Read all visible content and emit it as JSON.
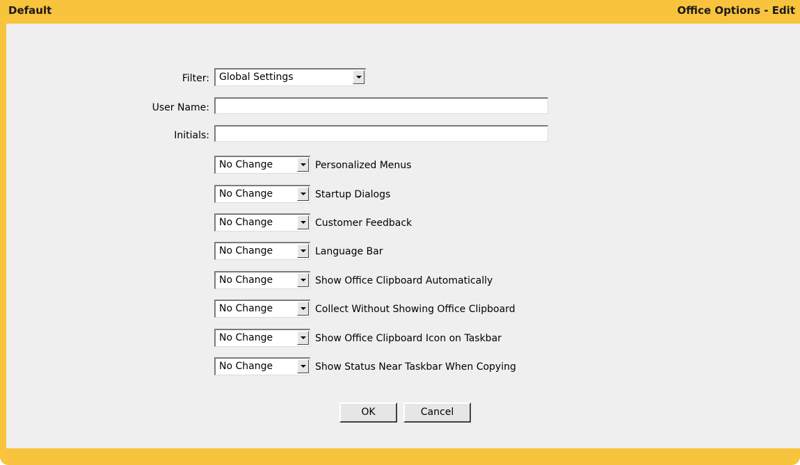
{
  "header": {
    "left_title": "Default",
    "right_title": "Office Options - Edit"
  },
  "form": {
    "filter": {
      "label": "Filter:",
      "value": "Global Settings"
    },
    "user_name": {
      "label": "User Name:",
      "value": ""
    },
    "initials": {
      "label": "Initials:",
      "value": ""
    },
    "options": [
      {
        "value": "No Change",
        "label": "Personalized Menus"
      },
      {
        "value": "No Change",
        "label": "Startup Dialogs"
      },
      {
        "value": "No Change",
        "label": "Customer Feedback"
      },
      {
        "value": "No Change",
        "label": "Language Bar"
      },
      {
        "value": "No Change",
        "label": "Show Office Clipboard Automatically"
      },
      {
        "value": "No Change",
        "label": "Collect Without Showing Office Clipboard"
      },
      {
        "value": "No Change",
        "label": "Show Office Clipboard Icon on Taskbar"
      },
      {
        "value": "No Change",
        "label": "Show Status Near Taskbar When Copying"
      }
    ]
  },
  "buttons": {
    "ok_label": "OK",
    "cancel_label": "Cancel"
  },
  "colors": {
    "frame": "#f8c33d",
    "panel": "#efefef"
  }
}
